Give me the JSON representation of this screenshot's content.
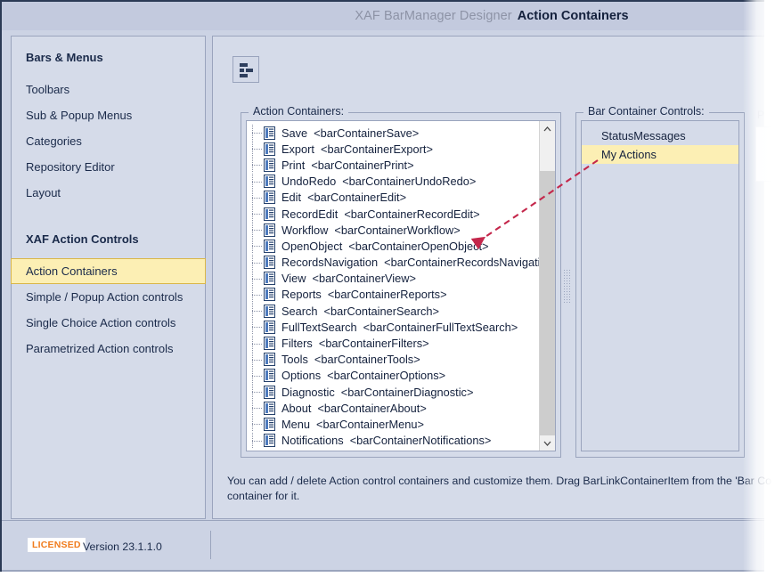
{
  "window": {
    "title_prefix": "XAF BarManager Designer",
    "title_main": "Action Containers"
  },
  "colors": {
    "window_bg": "#ccd3e4",
    "panel_bg": "#d5dbe9",
    "titlebar_bg": "#c3cade",
    "border": "#9aa4bd",
    "selection_yellow": "#fcefb4",
    "selection_border": "#d9b64a",
    "text": "#14213d",
    "muted_text": "#8d93a6",
    "accent_orange": "#f07c1e",
    "annotation_red": "#c4274b",
    "list_bg": "#ffffff"
  },
  "sidebar": {
    "groups": [
      {
        "title": "Bars & Menus",
        "items": [
          {
            "label": "Toolbars",
            "selected": false
          },
          {
            "label": "Sub & Popup Menus",
            "selected": false
          },
          {
            "label": "Categories",
            "selected": false
          },
          {
            "label": "Repository Editor",
            "selected": false
          },
          {
            "label": "Layout",
            "selected": false
          }
        ]
      },
      {
        "title": "XAF Action Controls",
        "items": [
          {
            "label": "Action Containers",
            "selected": true
          },
          {
            "label": "Simple / Popup Action controls",
            "selected": false
          },
          {
            "label": "Single Choice Action controls",
            "selected": false
          },
          {
            "label": "Parametrized Action controls",
            "selected": false
          }
        ]
      }
    ]
  },
  "toolbar": {
    "button_icon": "bar-layout-icon"
  },
  "action_containers": {
    "group_label": "Action Containers:",
    "items": [
      {
        "name": "Save",
        "tag": "<barContainerSave>"
      },
      {
        "name": "Export",
        "tag": "<barContainerExport>"
      },
      {
        "name": "Print",
        "tag": "<barContainerPrint>"
      },
      {
        "name": "UndoRedo",
        "tag": "<barContainerUndoRedo>"
      },
      {
        "name": "Edit",
        "tag": "<barContainerEdit>"
      },
      {
        "name": "RecordEdit",
        "tag": "<barContainerRecordEdit>"
      },
      {
        "name": "Workflow",
        "tag": "<barContainerWorkflow>"
      },
      {
        "name": "OpenObject",
        "tag": "<barContainerOpenObject>"
      },
      {
        "name": "RecordsNavigation",
        "tag": "<barContainerRecordsNavigation>"
      },
      {
        "name": "View",
        "tag": "<barContainerView>"
      },
      {
        "name": "Reports",
        "tag": "<barContainerReports>"
      },
      {
        "name": "Search",
        "tag": "<barContainerSearch>"
      },
      {
        "name": "FullTextSearch",
        "tag": "<barContainerFullTextSearch>"
      },
      {
        "name": "Filters",
        "tag": "<barContainerFilters>"
      },
      {
        "name": "Tools",
        "tag": "<barContainerTools>"
      },
      {
        "name": "Options",
        "tag": "<barContainerOptions>"
      },
      {
        "name": "Diagnostic",
        "tag": "<barContainerDiagnostic>"
      },
      {
        "name": "About",
        "tag": "<barContainerAbout>"
      },
      {
        "name": "Menu",
        "tag": "<barContainerMenu>"
      },
      {
        "name": "Notifications",
        "tag": "<barContainerNotifications>"
      }
    ],
    "scrollbar": {
      "up_arrow": "chevron-up-icon",
      "down_arrow": "chevron-down-icon"
    }
  },
  "bar_container_controls": {
    "group_label": "Bar Container Controls:",
    "items": [
      {
        "label": "StatusMessages",
        "selected": false
      },
      {
        "label": "My Actions",
        "selected": true
      }
    ]
  },
  "description": {
    "line1": "You can add / delete Action control containers and customize them. Drag BarLinkContainerItem from the 'Bar Container Con",
    "line2": "container for it."
  },
  "footer": {
    "license_badge": "LICENSED",
    "version": "Version 23.1.1.0"
  },
  "ghost_panel": {
    "label": "P"
  }
}
